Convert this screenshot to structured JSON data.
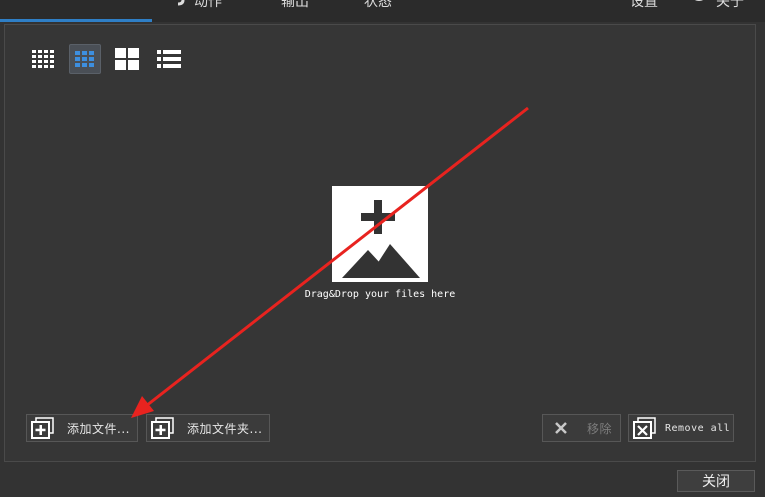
{
  "topbar": {
    "tabs": [
      {
        "label": "",
        "icon": "crop-icon"
      },
      {
        "label": "动作",
        "icon": "action-icon"
      },
      {
        "label": "输出",
        "icon": "output-icon"
      },
      {
        "label": "状态",
        "icon": "status-icon"
      }
    ],
    "settings_label": "设置",
    "about_label": "关于"
  },
  "view_modes": [
    "small-grid",
    "medium-grid",
    "large-grid",
    "list"
  ],
  "active_view": "medium-grid",
  "drop_zone": {
    "text": "Drag&Drop your files here"
  },
  "buttons": {
    "add_files": "添加文件...",
    "add_folder": "添加文件夹...",
    "remove": "移除",
    "remove_all": "Remove all",
    "close": "关闭"
  },
  "colors": {
    "accent": "#2f7fc6",
    "annotation_arrow": "#e8231f"
  }
}
